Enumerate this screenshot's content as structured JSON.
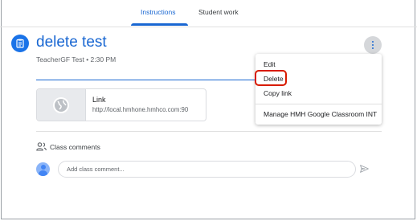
{
  "tabs": [
    {
      "label": "Instructions",
      "active": true
    },
    {
      "label": "Student work",
      "active": false
    }
  ],
  "assignment": {
    "icon": "assignment-icon",
    "title": "delete test",
    "meta": "TeacherGF Test • 2:30 PM"
  },
  "attachment": {
    "icon": "globe-icon",
    "title": "Link",
    "url": "http://local.hmhone.hmhco.com:90"
  },
  "comments": {
    "icon": "people-icon",
    "label": "Class comments",
    "placeholder": "Add class comment...",
    "send_icon": "send-icon"
  },
  "menu": {
    "items": [
      "Edit",
      "Delete",
      "Copy link",
      "Manage HMH Google Classroom INT"
    ],
    "highlighted": "Delete"
  },
  "colors": {
    "accent": "#1967d2",
    "highlight": "#d81b00"
  }
}
